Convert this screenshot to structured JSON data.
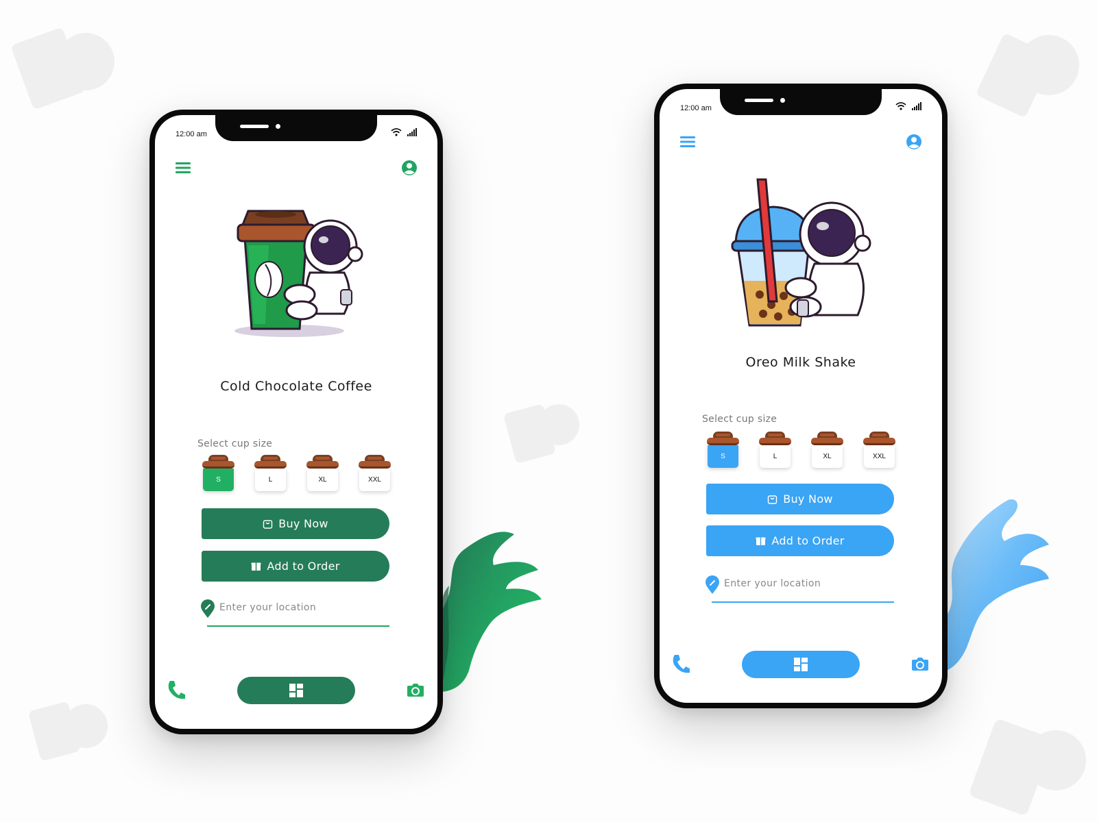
{
  "theme": {
    "green": {
      "accent": "#257c58",
      "bright": "#21b063"
    },
    "blue": {
      "accent": "#3aa4f5",
      "bright": "#3aa4f5"
    }
  },
  "phones": [
    {
      "status_time": "12:00 am",
      "product_name": "Cold Chocolate Coffee",
      "hero_icon": "astronaut-coffee-cup-illustration",
      "select_label": "Select cup size",
      "sizes": [
        "S",
        "L",
        "XL",
        "XXL"
      ],
      "selected_size": "S",
      "buy_label": "Buy Now",
      "add_label": "Add to Order",
      "location_placeholder": "Enter your location"
    },
    {
      "status_time": "12:00 am",
      "product_name": "Oreo Milk Shake",
      "hero_icon": "astronaut-bubble-tea-illustration",
      "select_label": "Select cup size",
      "sizes": [
        "S",
        "L",
        "XL",
        "XXL"
      ],
      "selected_size": "S",
      "buy_label": "Buy Now",
      "add_label": "Add to Order",
      "location_placeholder": "Enter your location"
    }
  ]
}
